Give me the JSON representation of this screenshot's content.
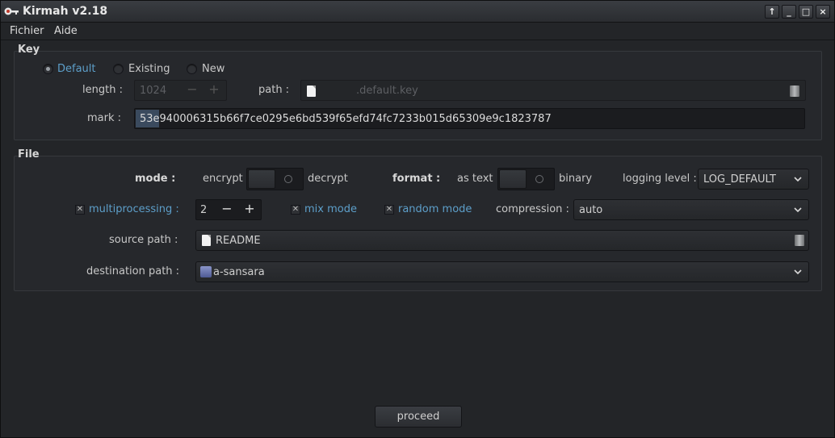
{
  "window": {
    "title": "Kirmah v2.18",
    "controls": [
      "↑",
      "_",
      "□",
      "×"
    ]
  },
  "menu": {
    "items": [
      "Fichier",
      "Aide"
    ]
  },
  "key": {
    "title": "Key",
    "options": [
      "Default",
      "Existing",
      "New"
    ],
    "selected": "Default",
    "length_label": "length :",
    "length_value": "1024",
    "path_label": "path :",
    "path_value": ".default.key",
    "mark_label": "mark :",
    "mark_value": "53e940006315b66f7ce0295e6bd539f65efd74fc7233b015d65309e9c1823787"
  },
  "file": {
    "title": "File",
    "mode_label": "mode :",
    "mode_left": "encrypt",
    "mode_right": "decrypt",
    "format_label": "format :",
    "format_left": "as text",
    "format_right": "binary",
    "logging_label": "logging level :",
    "logging_value": "LOG_DEFAULT",
    "multiprocessing_label": "multiprocessing :",
    "multiprocessing_checked": true,
    "multiprocessing_value": "2",
    "mix_mode_label": "mix mode",
    "mix_mode_checked": true,
    "random_mode_label": "random mode",
    "random_mode_checked": true,
    "compression_label": "compression :",
    "compression_value": "auto",
    "source_label": "source path :",
    "source_value": "README",
    "destination_label": "destination path :",
    "destination_value": "a-sansara"
  },
  "actions": {
    "proceed": "proceed"
  },
  "colors": {
    "accent": "#5d9fca",
    "background": "#232528"
  }
}
